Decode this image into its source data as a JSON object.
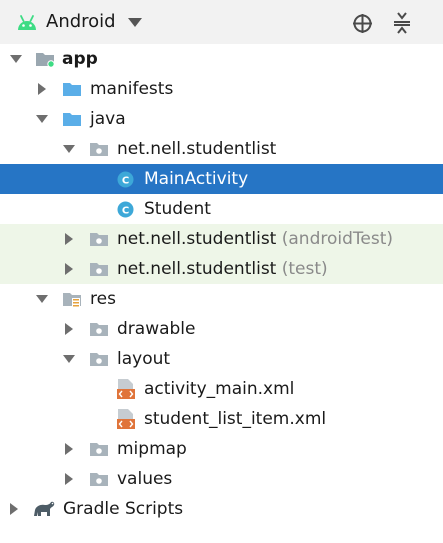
{
  "toolbar": {
    "view_title": "Android",
    "icons": [
      "android-icon",
      "dropdown-arrow-icon",
      "locate-icon",
      "collapse-all-icon"
    ]
  },
  "tree": [
    {
      "label": "app",
      "expanded": true,
      "icon": "module-folder-icon"
    },
    {
      "label": "manifests",
      "expanded": false,
      "icon": "folder-icon"
    },
    {
      "label": "java",
      "expanded": true,
      "icon": "folder-icon"
    },
    {
      "label": "net.nell.studentlist",
      "expanded": true,
      "icon": "package-icon"
    },
    {
      "label": "MainActivity",
      "icon": "class-icon",
      "selected": true
    },
    {
      "label": "Student",
      "icon": "class-icon"
    },
    {
      "label": "net.nell.studentlist",
      "suffix": "(androidTest)",
      "expanded": false,
      "icon": "package-icon"
    },
    {
      "label": "net.nell.studentlist",
      "suffix": "(test)",
      "expanded": false,
      "icon": "package-icon"
    },
    {
      "label": "res",
      "expanded": true,
      "icon": "resource-folder-icon"
    },
    {
      "label": "drawable",
      "expanded": false,
      "icon": "package-icon"
    },
    {
      "label": "layout",
      "expanded": true,
      "icon": "package-icon"
    },
    {
      "label": "activity_main.xml",
      "icon": "layout-xml-icon"
    },
    {
      "label": "student_list_item.xml",
      "icon": "layout-xml-icon"
    },
    {
      "label": "mipmap",
      "expanded": false,
      "icon": "package-icon"
    },
    {
      "label": "values",
      "expanded": false,
      "icon": "package-icon"
    },
    {
      "label": "Gradle Scripts",
      "expanded": false,
      "icon": "gradle-icon"
    }
  ],
  "colors": {
    "selection": "#2675c5",
    "tested_row": "#eef6e8",
    "folder": "#5aaee8",
    "class_icon": "#3da8d8",
    "android_green": "#3ddc84",
    "xml_icon": "#e0743a",
    "muted_text": "#8a8a8a"
  }
}
